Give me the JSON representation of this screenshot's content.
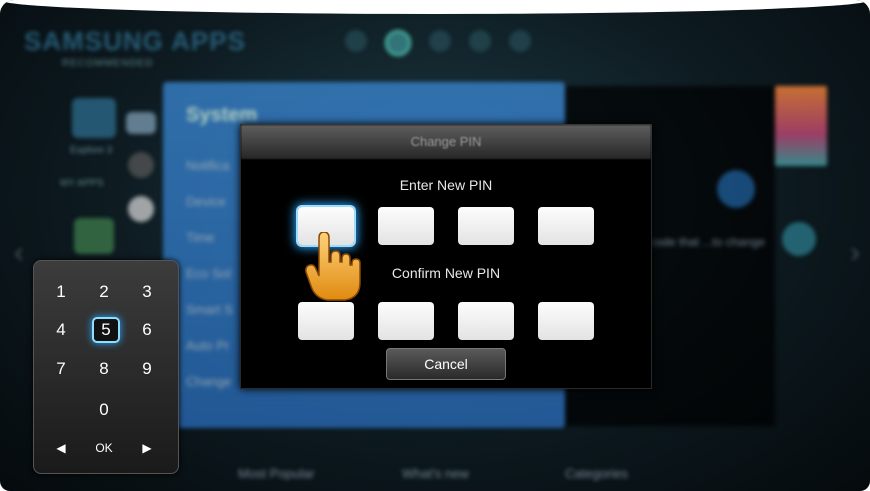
{
  "store": {
    "title": "SAMSUNG APPS",
    "section_recommended": "RECOMMENDED",
    "section_myapps": "MY APPS",
    "tile_label": "Explore 3",
    "bottom_nav": [
      "Most Popular",
      "What's new",
      "Categories"
    ]
  },
  "system_menu": {
    "title": "System",
    "items": [
      "Notifica",
      "Device",
      "Time",
      "Eco Sol",
      "Smart S",
      "Auto Pr",
      "Change"
    ]
  },
  "right_panel": {
    "text": "...ge code that ...to change the"
  },
  "dialog": {
    "title": "Change PIN",
    "enter_label": "Enter New PIN",
    "confirm_label": "Confirm New PIN",
    "enter_pin": [
      "",
      "",
      "",
      ""
    ],
    "confirm_pin": [
      "",
      "",
      "",
      ""
    ],
    "cancel_label": "Cancel"
  },
  "keypad": {
    "keys": [
      "1",
      "2",
      "3",
      "4",
      "5",
      "6",
      "7",
      "8",
      "9",
      "0"
    ],
    "selected_key": "5",
    "left_arrow": "◀",
    "ok": "OK",
    "right_arrow": "▶"
  },
  "colors": {
    "focus_glow": "#2aa8ff",
    "system_panel": "#3a86d0",
    "hand": "#f5a623"
  }
}
